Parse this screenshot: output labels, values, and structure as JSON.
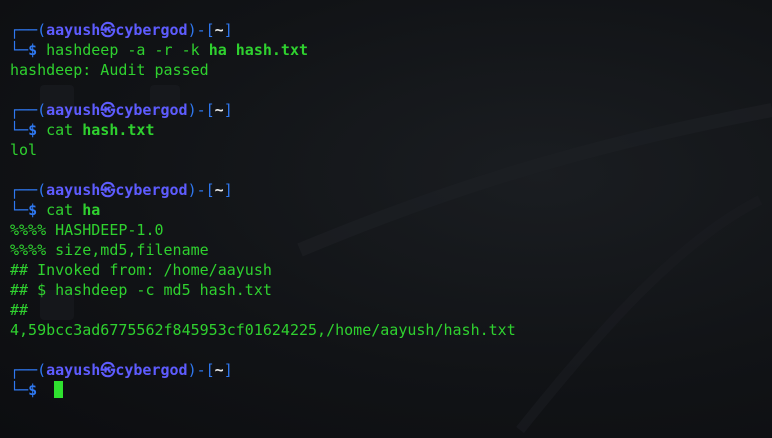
{
  "prompt": {
    "corner_top": "┌──",
    "user": "aayush",
    "skull": "㉿",
    "host": "cybergod",
    "dash": "-",
    "dir": "~",
    "corner_bottom": "└─",
    "dollar": "$"
  },
  "blocks": [
    {
      "command": {
        "cmd": "hashdeep",
        "args": " -a -r -k ",
        "bold_args": "ha hash.txt"
      },
      "output": [
        "hashdeep: Audit passed"
      ]
    },
    {
      "command": {
        "cmd": "cat",
        "args": " ",
        "bold_args": "hash.txt"
      },
      "output": [
        "lol"
      ]
    },
    {
      "command": {
        "cmd": "cat",
        "args": " ",
        "bold_args": "ha"
      },
      "output": [
        "%%%% HASHDEEP-1.0",
        "%%%% size,md5,filename",
        "## Invoked from: /home/aayush",
        "## $ hashdeep -c md5 hash.txt",
        "##",
        "4,59bcc3ad6775562f845953cf01624225,/home/aayush/hash.txt"
      ]
    }
  ],
  "colors": {
    "prompt_frame": "#2f78f0",
    "user_host": "#5e5cff",
    "text_green": "#2fd12f",
    "background": "#0f1114"
  }
}
